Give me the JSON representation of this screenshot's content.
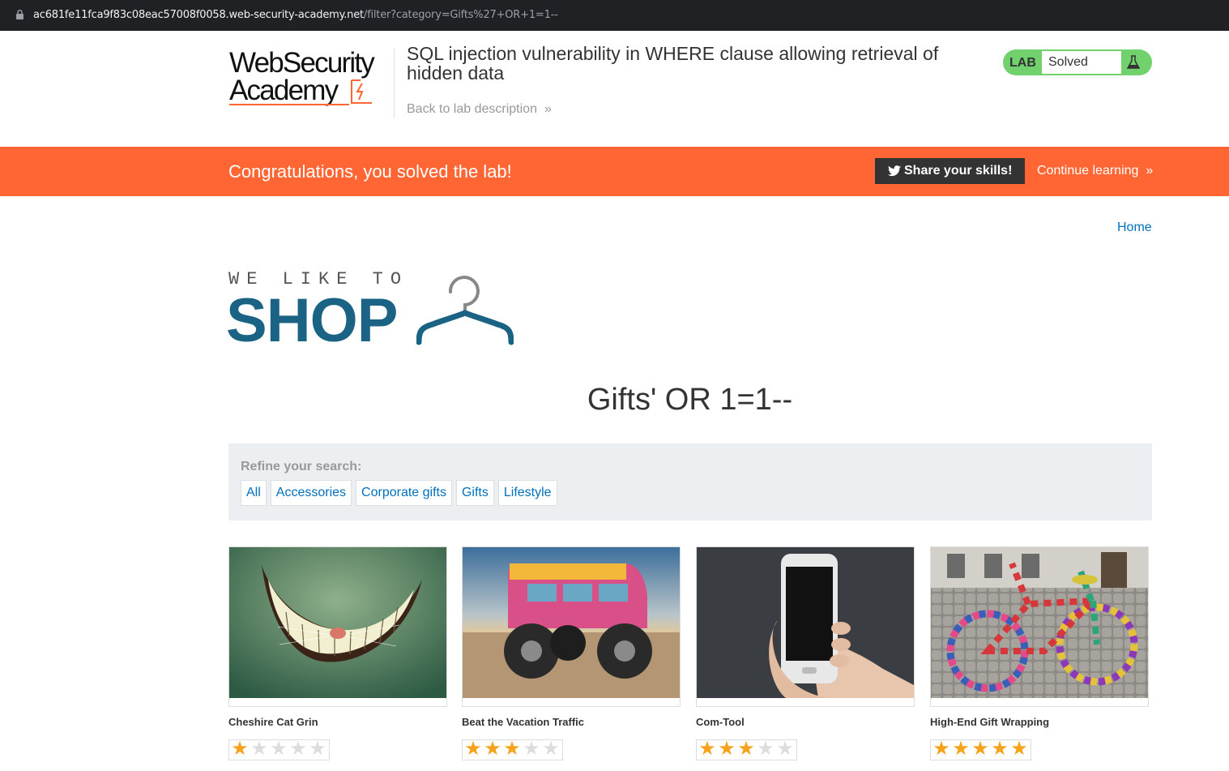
{
  "browser": {
    "url_host": "ac681fe11fca9f83c08eac57008f0058.web-security-academy.net",
    "url_path": "/filter?category=Gifts%27+OR+1=1--"
  },
  "header": {
    "logo_line1": "WebSecurity",
    "logo_line2": "Academy",
    "lab_title": "SQL injection vulnerability in WHERE clause allowing retrieval of hidden data",
    "back_link": "Back to lab description",
    "badge_lab": "LAB",
    "badge_status": "Solved"
  },
  "banner": {
    "message": "Congratulations, you solved the lab!",
    "share_label": "Share your skills!",
    "continue_label": "Continue learning"
  },
  "nav": {
    "home": "Home"
  },
  "shop_logo": {
    "tagline": "WE LIKE TO",
    "word": "SHOP"
  },
  "category_heading": "Gifts' OR 1=1--",
  "refine": {
    "label": "Refine your search:",
    "filters": [
      "All",
      "Accessories",
      "Corporate gifts",
      "Gifts",
      "Lifestyle"
    ]
  },
  "products": [
    {
      "name": "Cheshire Cat Grin",
      "rating": 1,
      "image": "cheshire-cat-grin-image"
    },
    {
      "name": "Beat the Vacation Traffic",
      "rating": 3,
      "image": "monster-van-image"
    },
    {
      "name": "Com-Tool",
      "rating": 3,
      "image": "smartphone-in-hand-image"
    },
    {
      "name": "High-End Gift Wrapping",
      "rating": 5,
      "image": "knitted-bike-image"
    }
  ],
  "colors": {
    "accent": "#ff6633",
    "link": "#0071bc",
    "badge": "#70d16d",
    "shop": "#1a6384",
    "star_on": "#f7a21b"
  }
}
